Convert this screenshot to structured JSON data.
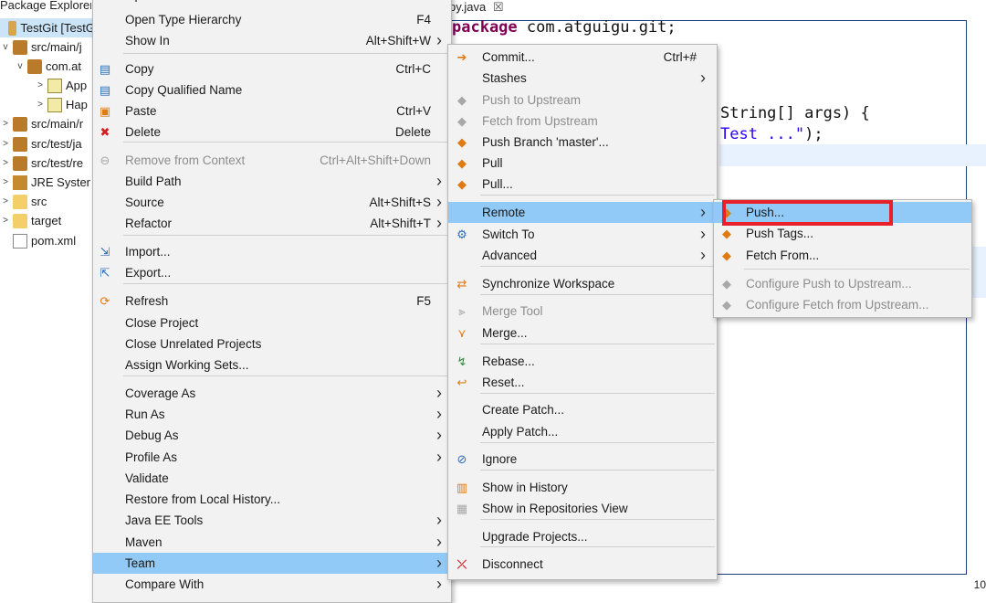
{
  "package_explorer": {
    "header": "Package Explorer",
    "tree": [
      {
        "label": "TestGit [TestG",
        "twisty": "",
        "icon": "project-icon"
      },
      {
        "label": "src/main/j",
        "twisty": "v",
        "icon": "source-folder-icon"
      },
      {
        "label": "com.at",
        "twisty": "v",
        "icon": "package-icon"
      },
      {
        "label": "App",
        "twisty": ">",
        "icon": "java-file-icon"
      },
      {
        "label": "Hap",
        "twisty": ">",
        "icon": "java-file-icon"
      },
      {
        "label": "src/main/r",
        "twisty": ">",
        "icon": "source-folder-icon"
      },
      {
        "label": "src/test/ja",
        "twisty": ">",
        "icon": "source-folder-icon"
      },
      {
        "label": "src/test/re",
        "twisty": ">",
        "icon": "source-folder-icon"
      },
      {
        "label": "JRE Syster",
        "twisty": ">",
        "icon": "library-icon"
      },
      {
        "label": "src",
        "twisty": ">",
        "icon": "folder-icon"
      },
      {
        "label": "target",
        "twisty": ">",
        "icon": "folder-icon"
      },
      {
        "label": "pom.xml",
        "twisty": "",
        "icon": "xml-file-icon"
      }
    ]
  },
  "editor": {
    "tab_label": "py.java",
    "tab_close": "☒",
    "code_line1_kw": "package",
    "code_line1_rest": " com.atguigu.git;",
    "code_line2": "String[] args) {",
    "code_line3_str": "Test ...\"",
    "code_line3_rest": ");",
    "corner_number": "10"
  },
  "context_menu": {
    "items": [
      {
        "label": "Open in New Window",
        "shortcut": "",
        "arrow": false,
        "icon": "",
        "disabled": false
      },
      {
        "label": "Open Type Hierarchy",
        "shortcut": "F4",
        "arrow": false,
        "icon": "",
        "disabled": false
      },
      {
        "label": "Show In",
        "shortcut": "Alt+Shift+W",
        "arrow": true,
        "icon": "",
        "disabled": false
      },
      {
        "label": "Copy",
        "shortcut": "Ctrl+C",
        "arrow": false,
        "icon": "copy-icon",
        "disabled": false
      },
      {
        "label": "Copy Qualified Name",
        "shortcut": "",
        "arrow": false,
        "icon": "copy-qualified-name-icon",
        "disabled": false
      },
      {
        "label": "Paste",
        "shortcut": "Ctrl+V",
        "arrow": false,
        "icon": "paste-icon",
        "disabled": false
      },
      {
        "label": "Delete",
        "shortcut": "Delete",
        "arrow": false,
        "icon": "delete-icon",
        "disabled": false
      },
      {
        "label": "Remove from Context",
        "shortcut": "Ctrl+Alt+Shift+Down",
        "arrow": false,
        "icon": "remove-from-context-icon",
        "disabled": true
      },
      {
        "label": "Build Path",
        "shortcut": "",
        "arrow": true,
        "icon": "",
        "disabled": false
      },
      {
        "label": "Source",
        "shortcut": "Alt+Shift+S",
        "arrow": true,
        "icon": "",
        "disabled": false
      },
      {
        "label": "Refactor",
        "shortcut": "Alt+Shift+T",
        "arrow": true,
        "icon": "",
        "disabled": false
      },
      {
        "label": "Import...",
        "shortcut": "",
        "arrow": false,
        "icon": "import-icon",
        "disabled": false
      },
      {
        "label": "Export...",
        "shortcut": "",
        "arrow": false,
        "icon": "export-icon",
        "disabled": false
      },
      {
        "label": "Refresh",
        "shortcut": "F5",
        "arrow": false,
        "icon": "refresh-icon",
        "disabled": false
      },
      {
        "label": "Close Project",
        "shortcut": "",
        "arrow": false,
        "icon": "",
        "disabled": false
      },
      {
        "label": "Close Unrelated Projects",
        "shortcut": "",
        "arrow": false,
        "icon": "",
        "disabled": false
      },
      {
        "label": "Assign Working Sets...",
        "shortcut": "",
        "arrow": false,
        "icon": "",
        "disabled": false
      },
      {
        "label": "Coverage As",
        "shortcut": "",
        "arrow": true,
        "icon": "",
        "disabled": false
      },
      {
        "label": "Run As",
        "shortcut": "",
        "arrow": true,
        "icon": "",
        "disabled": false
      },
      {
        "label": "Debug As",
        "shortcut": "",
        "arrow": true,
        "icon": "",
        "disabled": false
      },
      {
        "label": "Profile As",
        "shortcut": "",
        "arrow": true,
        "icon": "",
        "disabled": false
      },
      {
        "label": "Validate",
        "shortcut": "",
        "arrow": false,
        "icon": "",
        "disabled": false
      },
      {
        "label": "Restore from Local History...",
        "shortcut": "",
        "arrow": false,
        "icon": "",
        "disabled": false
      },
      {
        "label": "Java EE Tools",
        "shortcut": "",
        "arrow": true,
        "icon": "",
        "disabled": false
      },
      {
        "label": "Maven",
        "shortcut": "",
        "arrow": true,
        "icon": "",
        "disabled": false
      },
      {
        "label": "Team",
        "shortcut": "",
        "arrow": true,
        "icon": "",
        "disabled": false,
        "active": true
      },
      {
        "label": "Compare With",
        "shortcut": "",
        "arrow": true,
        "icon": "",
        "disabled": false
      }
    ]
  },
  "team_menu": {
    "items": [
      {
        "label": "Commit...",
        "shortcut": "Ctrl+#",
        "arrow": false,
        "icon": "commit-icon",
        "disabled": false
      },
      {
        "label": "Stashes",
        "shortcut": "",
        "arrow": true,
        "icon": "",
        "disabled": false
      },
      {
        "label": "Push to Upstream",
        "shortcut": "",
        "arrow": false,
        "icon": "push-upstream-icon",
        "disabled": true
      },
      {
        "label": "Fetch from Upstream",
        "shortcut": "",
        "arrow": false,
        "icon": "fetch-upstream-icon",
        "disabled": true
      },
      {
        "label": "Push Branch 'master'...",
        "shortcut": "",
        "arrow": false,
        "icon": "push-branch-icon",
        "disabled": false
      },
      {
        "label": "Pull",
        "shortcut": "",
        "arrow": false,
        "icon": "pull-icon",
        "disabled": false
      },
      {
        "label": "Pull...",
        "shortcut": "",
        "arrow": false,
        "icon": "pull-dialog-icon",
        "disabled": false
      },
      {
        "label": "Remote",
        "shortcut": "",
        "arrow": true,
        "icon": "",
        "disabled": false,
        "active": true
      },
      {
        "label": "Switch To",
        "shortcut": "",
        "arrow": true,
        "icon": "switch-to-icon",
        "disabled": false
      },
      {
        "label": "Advanced",
        "shortcut": "",
        "arrow": true,
        "icon": "",
        "disabled": false
      },
      {
        "label": "Synchronize Workspace",
        "shortcut": "",
        "arrow": false,
        "icon": "synchronize-icon",
        "disabled": false
      },
      {
        "label": "Merge Tool",
        "shortcut": "",
        "arrow": false,
        "icon": "merge-tool-icon",
        "disabled": true
      },
      {
        "label": "Merge...",
        "shortcut": "",
        "arrow": false,
        "icon": "merge-icon",
        "disabled": false
      },
      {
        "label": "Rebase...",
        "shortcut": "",
        "arrow": false,
        "icon": "rebase-icon",
        "disabled": false
      },
      {
        "label": "Reset...",
        "shortcut": "",
        "arrow": false,
        "icon": "reset-icon",
        "disabled": false
      },
      {
        "label": "Create Patch...",
        "shortcut": "",
        "arrow": false,
        "icon": "",
        "disabled": false
      },
      {
        "label": "Apply Patch...",
        "shortcut": "",
        "arrow": false,
        "icon": "",
        "disabled": false
      },
      {
        "label": "Ignore",
        "shortcut": "",
        "arrow": false,
        "icon": "ignore-icon",
        "disabled": false
      },
      {
        "label": "Show in History",
        "shortcut": "",
        "arrow": false,
        "icon": "history-icon",
        "disabled": false
      },
      {
        "label": "Show in Repositories View",
        "shortcut": "",
        "arrow": false,
        "icon": "git-repositories-icon",
        "disabled": false
      },
      {
        "label": "Upgrade Projects...",
        "shortcut": "",
        "arrow": false,
        "icon": "",
        "disabled": false
      },
      {
        "label": "Disconnect",
        "shortcut": "",
        "arrow": false,
        "icon": "disconnect-icon",
        "disabled": false
      }
    ]
  },
  "remote_menu": {
    "items": [
      {
        "label": "Push...",
        "icon": "push-icon",
        "disabled": false,
        "active": true
      },
      {
        "label": "Push Tags...",
        "icon": "push-tags-icon",
        "disabled": false
      },
      {
        "label": "Fetch From...",
        "icon": "fetch-icon",
        "disabled": false
      },
      {
        "label": "Configure Push to Upstream...",
        "icon": "configure-push-icon",
        "disabled": true
      },
      {
        "label": "Configure Fetch from Upstream...",
        "icon": "configure-fetch-icon",
        "disabled": true
      }
    ]
  },
  "colors": {
    "menu_background": "#f2f2f2",
    "menu_highlight": "#91c9f7",
    "annotation_box": "#e8202a",
    "disabled_text": "#8d8d8d"
  }
}
